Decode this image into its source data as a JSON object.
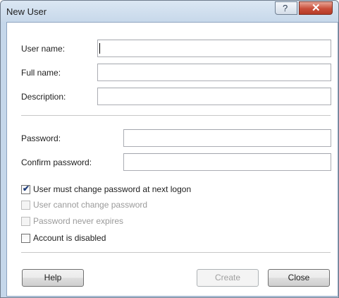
{
  "window": {
    "title": "New User",
    "help_glyph": "?",
    "close_glyph": "✕"
  },
  "fields": {
    "user_name": {
      "label": "User name:",
      "value": ""
    },
    "full_name": {
      "label": "Full name:",
      "value": ""
    },
    "description": {
      "label": "Description:",
      "value": ""
    },
    "password": {
      "label": "Password:",
      "value": ""
    },
    "confirm_password": {
      "label": "Confirm password:",
      "value": ""
    }
  },
  "checkboxes": [
    {
      "label": "User must change password at next logon",
      "checked": true,
      "enabled": true
    },
    {
      "label": "User cannot change password",
      "checked": false,
      "enabled": false
    },
    {
      "label": "Password never expires",
      "checked": false,
      "enabled": false
    },
    {
      "label": "Account is disabled",
      "checked": false,
      "enabled": true
    }
  ],
  "buttons": {
    "help": "Help",
    "create": "Create",
    "close": "Close"
  },
  "colors": {
    "frame": "#c5d7ea",
    "close_button": "#c94e3a",
    "checkmark": "#1f3d7a"
  }
}
